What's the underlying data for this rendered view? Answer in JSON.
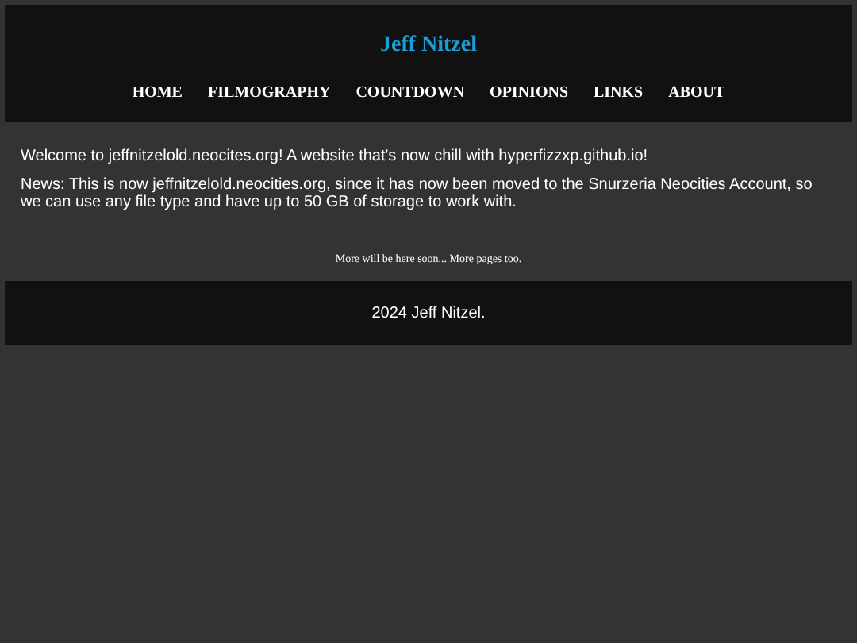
{
  "header": {
    "title": "Jeff Nitzel",
    "nav": [
      {
        "label": "HOME"
      },
      {
        "label": "FILMOGRAPHY"
      },
      {
        "label": "COUNTDOWN"
      },
      {
        "label": "OPINIONS"
      },
      {
        "label": "LINKS"
      },
      {
        "label": "ABOUT"
      }
    ]
  },
  "main": {
    "paragraphs": [
      "Welcome to jeffnitzelold.neocites.org! A website that's now chill with hyperfizzxp.github.io!",
      "News: This is now jeffnitzelold.neocities.org, since it has now been moved to the Snurzeria Neocities Account, so we can use any file type and have up to 50 GB of storage to work with."
    ],
    "note": "More will be here soon... More pages too."
  },
  "footer": {
    "text": "2024 Jeff Nitzel."
  }
}
